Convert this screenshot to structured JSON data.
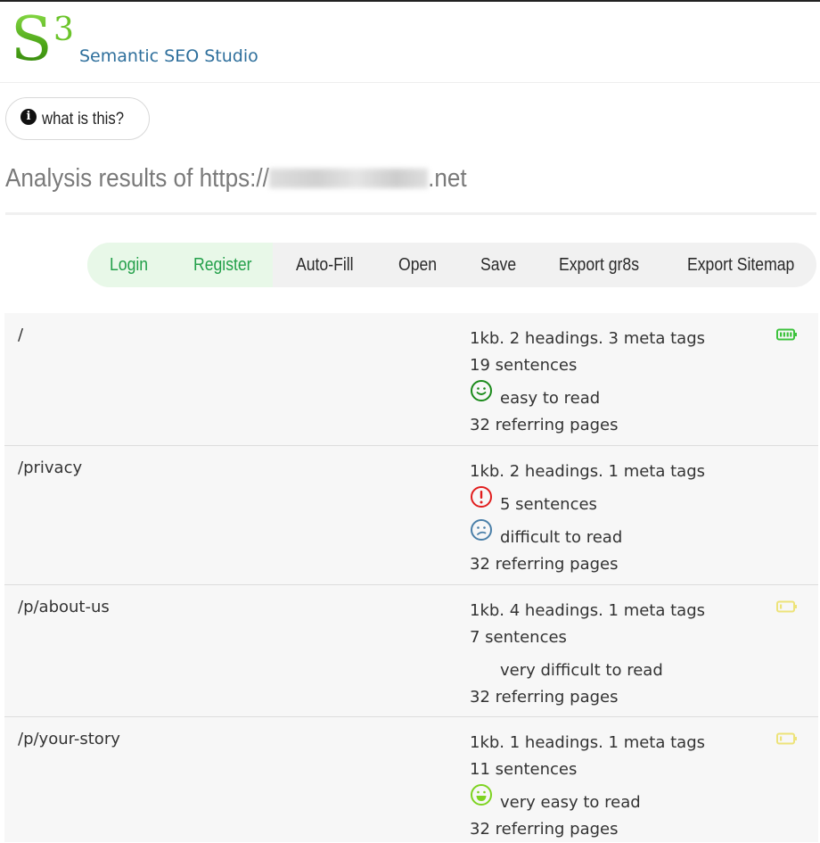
{
  "header": {
    "logo_letter": "S",
    "logo_superscript": "3",
    "app_name": "Semantic SEO Studio"
  },
  "info_button": {
    "label": "what is this?"
  },
  "page": {
    "title_prefix": "Analysis results of https://",
    "title_suffix": ".net"
  },
  "nav": {
    "items": [
      {
        "label": "Login"
      },
      {
        "label": "Register"
      },
      {
        "label": "Auto-Fill"
      },
      {
        "label": "Open"
      },
      {
        "label": "Save"
      },
      {
        "label": "Export gr8s"
      },
      {
        "label": "Export Sitemap"
      }
    ]
  },
  "colors": {
    "logo_green": "#5cb81e",
    "subtitle_blue": "#2e6f9c",
    "nav_green": "#23a04a",
    "smile_green": "#1a8a1a",
    "alert_red": "#e11d1d",
    "sad_blue": "#4a7fa8",
    "bright_green": "#7ed321",
    "battery_full": "#3cc23c",
    "battery_low": "#ede37a"
  },
  "results": [
    {
      "path": "/",
      "summary": "1kb. 2 headings. 3 meta tags",
      "sentences": "19 sentences",
      "sentences_icon": "",
      "readability": "easy to read",
      "readability_icon": "smile-icon",
      "referring": "32 referring pages",
      "battery_icon": "battery-full-icon"
    },
    {
      "path": "/privacy",
      "summary": "1kb. 2 headings. 1 meta tags",
      "sentences": "5 sentences",
      "sentences_icon": "alert-icon",
      "readability": "difficult to read",
      "readability_icon": "confused-icon",
      "referring": "32 referring pages",
      "battery_icon": ""
    },
    {
      "path": "/p/about-us",
      "summary": "1kb. 4 headings. 1 meta tags",
      "sentences": "7 sentences",
      "sentences_icon": "",
      "readability": "very difficult to read",
      "readability_icon": "",
      "referring": "32 referring pages",
      "battery_icon": "battery-low-icon"
    },
    {
      "path": "/p/your-story",
      "summary": "1kb. 1 headings. 1 meta tags",
      "sentences": "11 sentences",
      "sentences_icon": "",
      "readability": "very easy to read",
      "readability_icon": "grin-icon",
      "referring": "32 referring pages",
      "battery_icon": "battery-low-icon"
    }
  ]
}
